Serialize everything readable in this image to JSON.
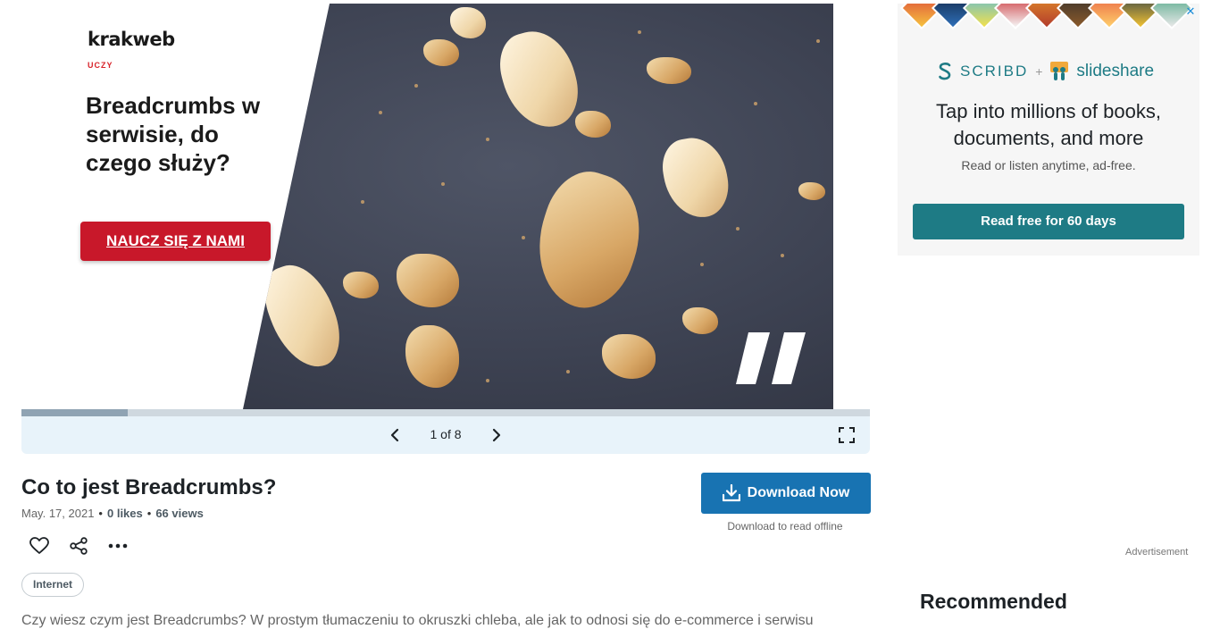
{
  "slide": {
    "brand_name": "krakweb",
    "brand_sub": "UCZY",
    "headline": "Breadcrumbs w serwisie, do czego służy?",
    "cta_label": "NAUCZ SIĘ Z NAMI"
  },
  "viewer": {
    "counter": "1 of 8",
    "progress_fraction": 0.125
  },
  "document": {
    "title": "Co to jest Breadcrumbs?",
    "date": "May. 17, 2021",
    "likes": "0 likes",
    "views": "66 views",
    "tag": "Internet",
    "description": "Czy wiesz czym jest Breadcrumbs? W prostym tłumaczeniu to okruszki chleba, ale jak to odnosi się do e-commerce i serwisu"
  },
  "download": {
    "button_label": "Download Now",
    "sub_label": "Download to read offline"
  },
  "ad": {
    "close_label": "✕",
    "scribd": "SCRIBD",
    "plus": "+",
    "slideshare": "slideshare",
    "headline": "Tap into millions of books, documents, and more",
    "subtext": "Read or listen anytime, ad-free.",
    "button_label": "Read free for 60 days",
    "label": "Advertisement"
  },
  "sidebar": {
    "recommended_title": "Recommended"
  },
  "colors": {
    "download_blue": "#1873b2",
    "scribd_teal": "#1e7b85",
    "cta_red": "#c8182a",
    "viewer_bar": "#e8f3fa"
  },
  "icons": [
    "chevron-left-icon",
    "chevron-right-icon",
    "fullscreen-icon",
    "download-icon",
    "heart-icon",
    "share-icon",
    "more-icon",
    "scribd-logo-icon",
    "slideshare-logo-icon",
    "close-icon"
  ]
}
